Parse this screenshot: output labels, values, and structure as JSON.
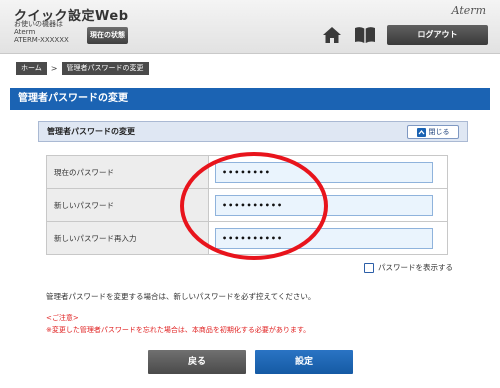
{
  "header": {
    "app_title": "クイック設定Web",
    "model_label": "お使いの機器は",
    "model_value": "Aterm",
    "model_sub": "ATERM-XXXXXX",
    "status_button": "現在の状態",
    "brand_logo": "Aterm",
    "home_icon": "home-icon",
    "manual_icon": "book-icon",
    "logout_button": "ログアウト"
  },
  "breadcrumb": {
    "home": "ホーム",
    "separator": ">",
    "current": "管理者パスワードの変更"
  },
  "page_title": "管理者パスワードの変更",
  "panel": {
    "title": "管理者パスワードの変更",
    "close_label": "閉じる"
  },
  "form": {
    "rows": [
      {
        "label": "現在のパスワード",
        "value": "••••••••"
      },
      {
        "label": "新しいパスワード",
        "value": "••••••••••"
      },
      {
        "label": "新しいパスワード再入力",
        "value": "••••••••••"
      }
    ],
    "show_password_label": "パスワードを表示する",
    "show_password_checked": false
  },
  "notice": "管理者パスワードを変更する場合は、新しいパスワードを必ず控えてください。",
  "warning": {
    "title": "<ご注意>",
    "text": "※変更した管理者パスワードを忘れた場合は、本商品を初期化する必要があります。"
  },
  "buttons": {
    "back": "戻る",
    "submit": "設定"
  },
  "colors": {
    "accent": "#1b63b3",
    "warning": "#e02020",
    "annotation": "#e8141c"
  }
}
